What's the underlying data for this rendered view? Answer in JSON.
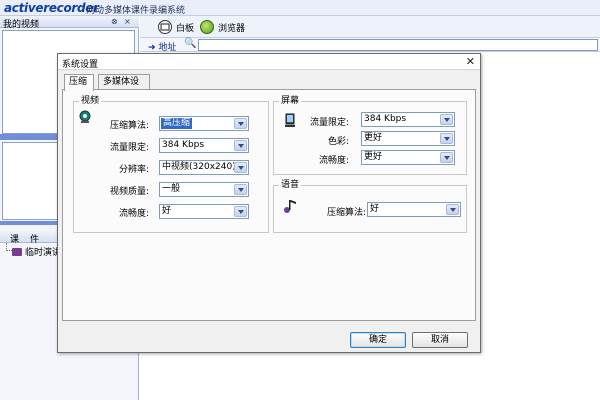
{
  "app": {
    "logo_text": "activerecorder",
    "title": "网动多媒体课件录编系统"
  },
  "left_pane": {
    "video_header": "我的视频",
    "video_header_buttons": [
      "⊗",
      "×"
    ],
    "course_header": [
      "课",
      "件"
    ],
    "course_items": [
      {
        "label": "临时演讲",
        "icon": "book-icon"
      }
    ]
  },
  "toolbar": {
    "whiteboard_label": "白板",
    "browser_label": "浏览器"
  },
  "address_bar": {
    "label": "地址",
    "value": ""
  },
  "dialog": {
    "title": "系统设置",
    "close_glyph": "✕",
    "tabs": [
      {
        "label": "压缩",
        "active": true
      },
      {
        "label": "多媒体设备",
        "active": false
      }
    ],
    "video_group": {
      "title": "视频",
      "icon": "camera-icon",
      "fields": [
        {
          "label": "压缩算法:",
          "value": "高压缩",
          "selected": true
        },
        {
          "label": "流量限定:",
          "value": "384 Kbps"
        },
        {
          "label": "分辨率:",
          "value": "中视频(320x240)"
        },
        {
          "label": "视频质量:",
          "value": "一般"
        },
        {
          "label": "流畅度:",
          "value": "好"
        }
      ]
    },
    "screen_group": {
      "title": "屏幕",
      "icon": "monitor-icon",
      "fields": [
        {
          "label": "流量限定:",
          "value": "384 Kbps"
        },
        {
          "label": "色彩:",
          "value": "更好"
        },
        {
          "label": "流畅度:",
          "value": "更好"
        }
      ]
    },
    "audio_group": {
      "title": "语音",
      "icon": "music-note-icon",
      "fields": [
        {
          "label": "压缩算法:",
          "value": "好"
        }
      ]
    },
    "buttons": {
      "ok_label": "确定",
      "cancel_label": "取消"
    }
  }
}
